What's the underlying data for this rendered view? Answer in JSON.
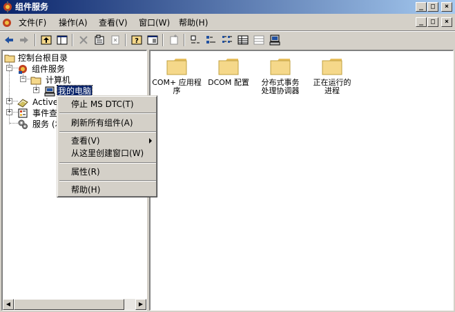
{
  "window": {
    "title": "组件服务",
    "minimize": "_",
    "maximize": "□",
    "close": "×"
  },
  "menubar": {
    "items": [
      "文件(F)",
      "操作(A)",
      "查看(V)",
      "窗口(W)",
      "帮助(H)"
    ]
  },
  "tree": {
    "root": "控制台根目录",
    "component_services": "组件服务",
    "computers": "计算机",
    "my_computer": "我的电脑",
    "active": "Active",
    "event_viewer": "事件查",
    "services": "服务 (本"
  },
  "list": {
    "items": [
      {
        "line1": "COM+ 应用程",
        "line2": "序"
      },
      {
        "line1": "DCOM 配置",
        "line2": ""
      },
      {
        "line1": "分布式事务",
        "line2": "处理协调器"
      },
      {
        "line1": "正在运行的",
        "line2": "进程"
      }
    ]
  },
  "context_menu": {
    "stop_msdtc": "停止 MS DTC(T)",
    "refresh_all": "刷新所有组件(A)",
    "view": "查看(V)",
    "new_window": "从这里创建窗口(W)",
    "properties": "属性(R)",
    "help": "帮助(H)"
  },
  "colors": {
    "title_start": "#0a246a",
    "title_end": "#a6caf0",
    "face": "#d4d0c8",
    "folder": "#f5d88a",
    "selection": "#0a246a"
  },
  "icons": [
    "component-services-icon",
    "back-arrow-icon",
    "forward-arrow-icon",
    "folder-up-icon",
    "show-tree-icon",
    "delete-icon",
    "properties-icon",
    "help-icon",
    "export-icon",
    "new-window-icon",
    "large-icons-icon",
    "small-icons-icon",
    "list-view-icon",
    "detail-view-icon",
    "computer-icon"
  ]
}
